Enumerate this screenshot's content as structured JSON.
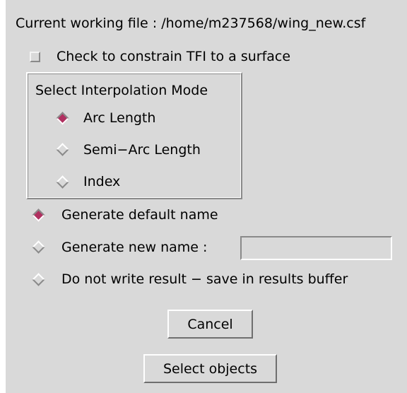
{
  "header": {
    "working_file_label": "Current working file : /home/m237568/wing_new.csf"
  },
  "constrain_checkbox": {
    "label": "Check to constrain TFI to a surface",
    "checked": false
  },
  "interpolation_mode": {
    "title": "Select Interpolation Mode",
    "options": [
      {
        "label": "Arc Length",
        "selected": true
      },
      {
        "label": "Semi−Arc Length",
        "selected": false
      },
      {
        "label": "Index",
        "selected": false
      }
    ]
  },
  "naming": {
    "options": [
      {
        "label": "Generate default name",
        "selected": true
      },
      {
        "label": "Generate new name :",
        "selected": false
      },
      {
        "label": "Do not write result − save in results buffer",
        "selected": false
      }
    ],
    "new_name_value": ""
  },
  "buttons": {
    "cancel": "Cancel",
    "select_objects": "Select objects"
  },
  "colors": {
    "background": "#d9d9d9",
    "radio_selected": "#b03060"
  },
  "icons": {
    "checkbox": "checkbox-icon",
    "radio_on": "radio-selected-icon",
    "radio_off": "radio-unselected-icon"
  }
}
